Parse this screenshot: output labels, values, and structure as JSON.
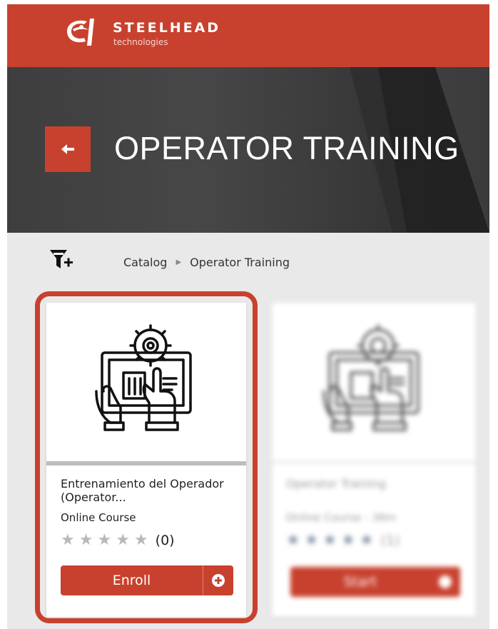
{
  "brand": {
    "name": "STEELHEAD",
    "tagline": "technologies",
    "logo_icon": "steelhead-logo-icon",
    "accent_color": "#c8412e"
  },
  "hero": {
    "title": "OPERATOR TRAINING",
    "back_icon": "back-arrow-icon"
  },
  "breadcrumb": {
    "filter_icon": "funnel-plus-icon",
    "items": [
      "Catalog",
      "Operator Training"
    ]
  },
  "courses": [
    {
      "title": "Entrenamiento del Operador (Operator...",
      "type": "Online Course",
      "stars": [
        "★",
        "★",
        "★",
        "★",
        "★"
      ],
      "rating_count": "(0)",
      "action_label": "Enroll",
      "action_icon": "plus-circle-icon",
      "thumbnail_icon": "hand-tablet-gear-icon",
      "selected": true
    },
    {
      "title": "Operator Training",
      "type": "Online Course - 36m",
      "stars": [
        "★",
        "★",
        "★",
        "★",
        "★"
      ],
      "rating_count": "(1)",
      "action_label": "Start",
      "action_icon": "arrow-circle-icon",
      "thumbnail_icon": "hand-tablet-gear-icon",
      "selected": false
    }
  ]
}
